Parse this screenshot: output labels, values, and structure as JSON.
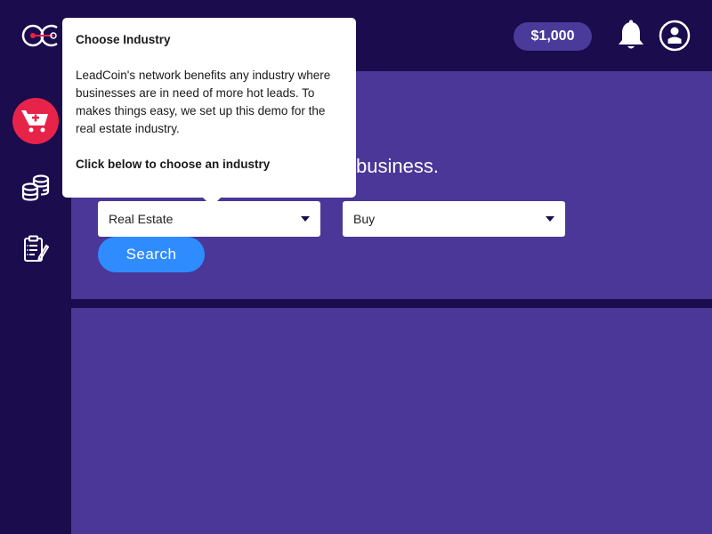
{
  "header": {
    "logo_icon": "leadcoin-logo-icon",
    "balance": "$1,000",
    "notifications_icon": "bell-icon",
    "profile_icon": "user-circle-icon"
  },
  "sidebar": {
    "items": [
      {
        "icon": "cart-plus-icon",
        "active": true
      },
      {
        "icon": "coins-stack-icon",
        "active": false
      },
      {
        "icon": "clipboard-edit-icon",
        "active": false
      }
    ]
  },
  "hero": {
    "heading": "business.",
    "industry_select": "Real Estate",
    "mode_select": "Buy",
    "search_label": "Search"
  },
  "tooltip": {
    "title": "Choose Industry",
    "body": "LeadCoin's network benefits any industry where businesses are in need of more hot leads. To makes things easy, we set up this demo for the real estate industry.",
    "cta": "Click below to choose an industry"
  },
  "colors": {
    "background": "#1a0c4d",
    "panel": "#4a3797",
    "accent_red": "#e8234a",
    "search_blue": "#2f8cff",
    "balance_pill": "#4a3a9a"
  }
}
